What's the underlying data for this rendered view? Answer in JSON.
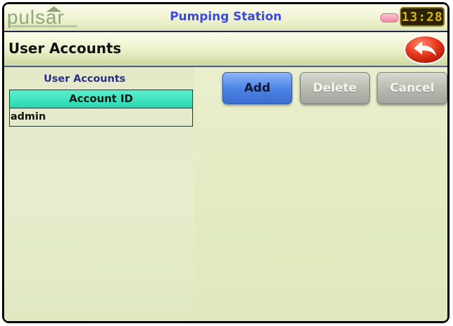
{
  "topbar": {
    "logo_text": "pulsar",
    "app_title": "Pumping Station",
    "clock": "13:28",
    "status_color": "#f08aa6"
  },
  "titlebar": {
    "title": "User Accounts",
    "back_icon": "back-arrow-icon"
  },
  "user_accounts": {
    "heading": "User Accounts",
    "column_header": "Account ID",
    "rows": [
      "admin"
    ]
  },
  "actions": {
    "add_label": "Add",
    "delete_label": "Delete",
    "cancel_label": "Cancel"
  },
  "colors": {
    "title_blue": "#3b47e8",
    "table_header": "#2ad6b2",
    "add_button": "#4d84e6",
    "back_button": "#e8391f"
  }
}
